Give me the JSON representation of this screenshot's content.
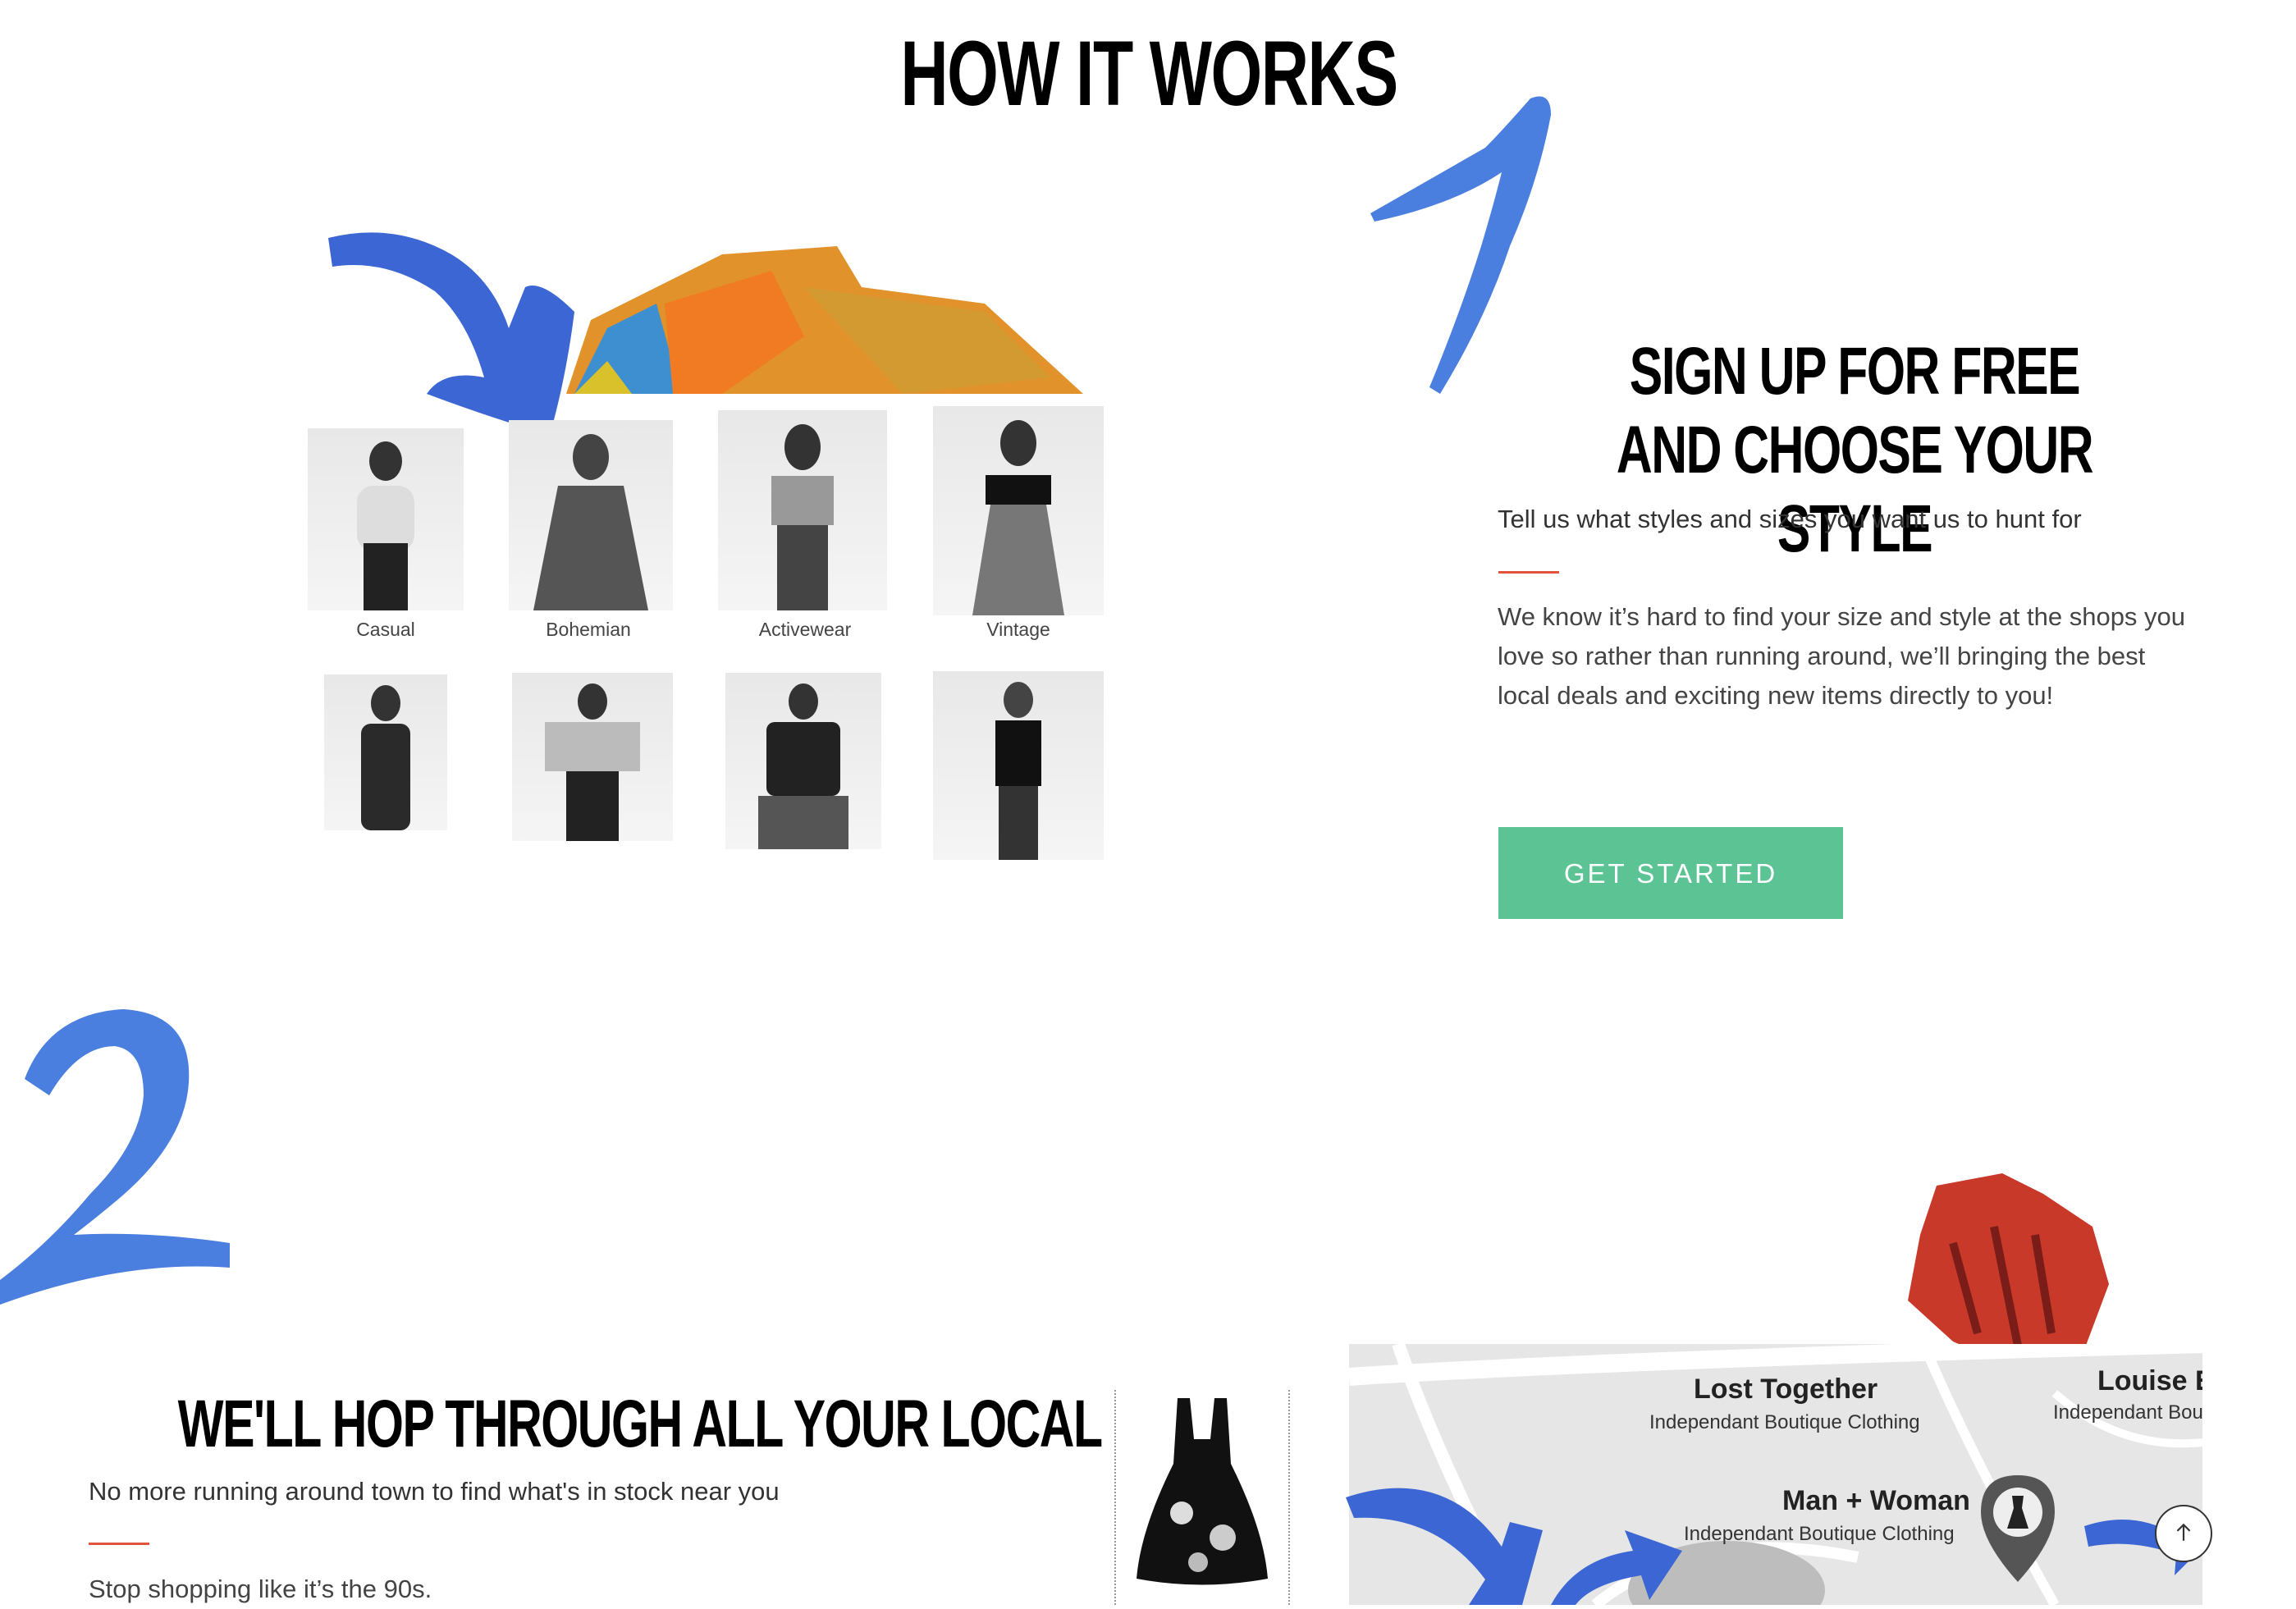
{
  "page": {
    "title": "HOW IT WORKS"
  },
  "step1": {
    "number": "1",
    "title": "SIGN UP FOR FREE AND CHOOSE YOUR STYLE",
    "subtitle": "Tell us what styles and sizes you want us to hunt for",
    "body": "We know it’s hard to find your size and style at the shops you love so rather than running around, we’ll bringing the best local deals and exciting new items directly to you!",
    "cta_label": "GET STARTED",
    "styles": [
      "Casual",
      "Bohemian",
      "Activewear",
      "Vintage"
    ]
  },
  "step2": {
    "number": "2",
    "title": "WE'LL HOP THROUGH ALL YOUR LOCAL SHOPS",
    "subtitle": "No more running around town to find what's in stock near you",
    "body": "Stop shopping like it’s the 90s."
  },
  "map": {
    "shops": [
      {
        "name": "Lost Together",
        "type": "Independant Boutique Clothing"
      },
      {
        "name": "Louise E",
        "type": "Independant Bou"
      },
      {
        "name": "Man + Woman",
        "type": "Independant Boutique Clothing"
      }
    ]
  },
  "colors": {
    "accent_blue": "#4a7fe0",
    "cta_green": "#5cc394",
    "divider_red": "#e0543a"
  },
  "icons": {
    "scroll_top": "arrow-up-icon",
    "map_pin": "map-pin-icon"
  }
}
